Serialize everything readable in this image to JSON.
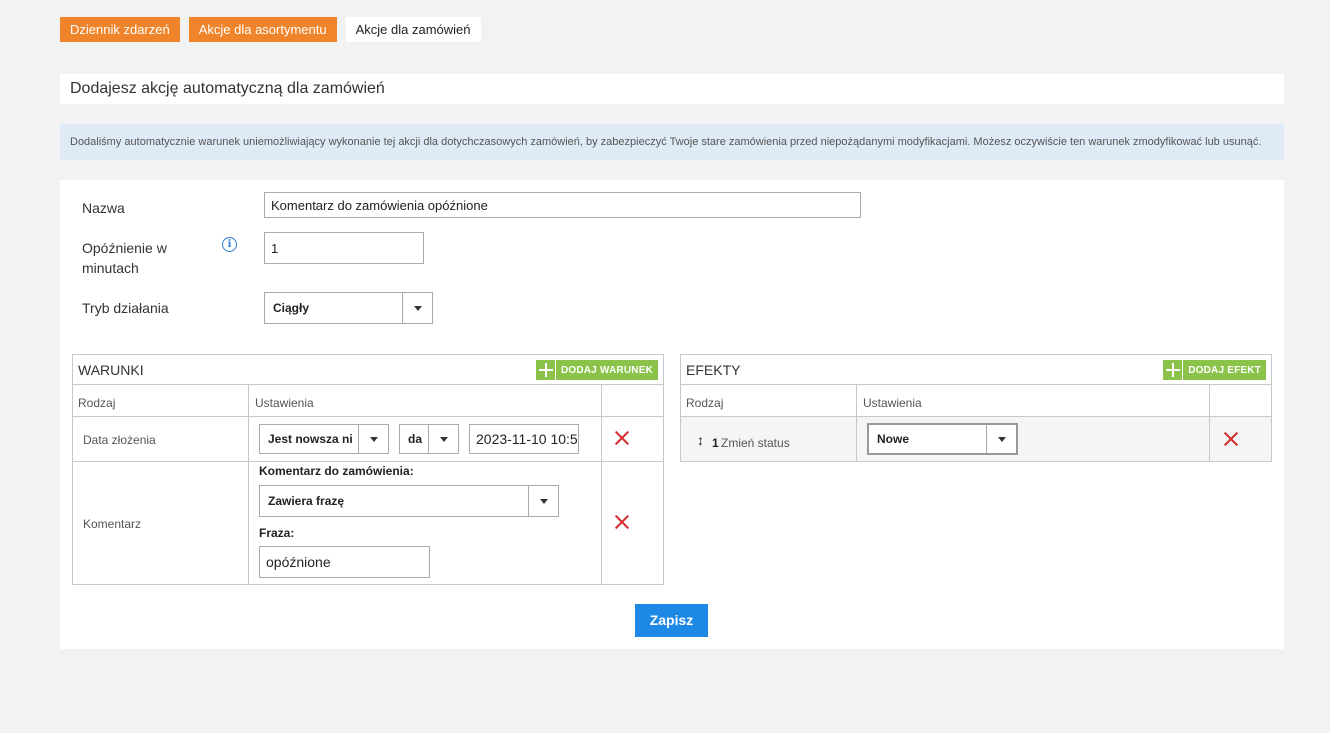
{
  "tabs": [
    {
      "label": "Dziennik zdarzeń"
    },
    {
      "label": "Akcje dla asortymentu"
    },
    {
      "label": "Akcje dla zamówień"
    }
  ],
  "page_title": "Dodajesz akcję automatyczną dla zamówień",
  "info_message": "Dodaliśmy automatycznie warunek uniemożliwiający wykonanie tej akcji dla dotychczasowych zamówień, by zabezpieczyć Twoje stare zamówienia przed niepożądanymi modyfikacjami. Możesz oczywiście ten warunek zmodyfikować lub usunąć.",
  "form": {
    "name_label": "Nazwa",
    "name_value": "Komentarz do zamówienia opóźnione",
    "delay_label_line1": "Opóźnienie w",
    "delay_label_line2": "minutach",
    "delay_info_icon": "i",
    "delay_value": "1",
    "mode_label": "Tryb działania",
    "mode_value": "Ciągły"
  },
  "conditions": {
    "title": "WARUNKI",
    "add_label": "DODAJ WARUNEK",
    "col_type": "Rodzaj",
    "col_settings": "Ustawienia",
    "rows": [
      {
        "type": "Data złożenia",
        "operator": "Jest nowsza ni",
        "unit": "da",
        "date_value": "2023-11-10 10:5"
      },
      {
        "type": "Komentarz",
        "comment_label": "Komentarz do zamówienia:",
        "match_value": "Zawiera frazę",
        "phrase_label": "Fraza:",
        "phrase_value": "opóźnione"
      }
    ]
  },
  "effects": {
    "title": "EFEKTY",
    "add_label": "DODAJ EFEKT",
    "col_type": "Rodzaj",
    "col_settings": "Ustawienia",
    "rows": [
      {
        "order": "1",
        "type": "Zmień status",
        "status_value": "Nowe"
      }
    ]
  },
  "save_label": "Zapisz",
  "colors": {
    "orange": "#f0842b",
    "green": "#8bc34a",
    "blue": "#1e88e5",
    "red": "#d32f2f"
  }
}
